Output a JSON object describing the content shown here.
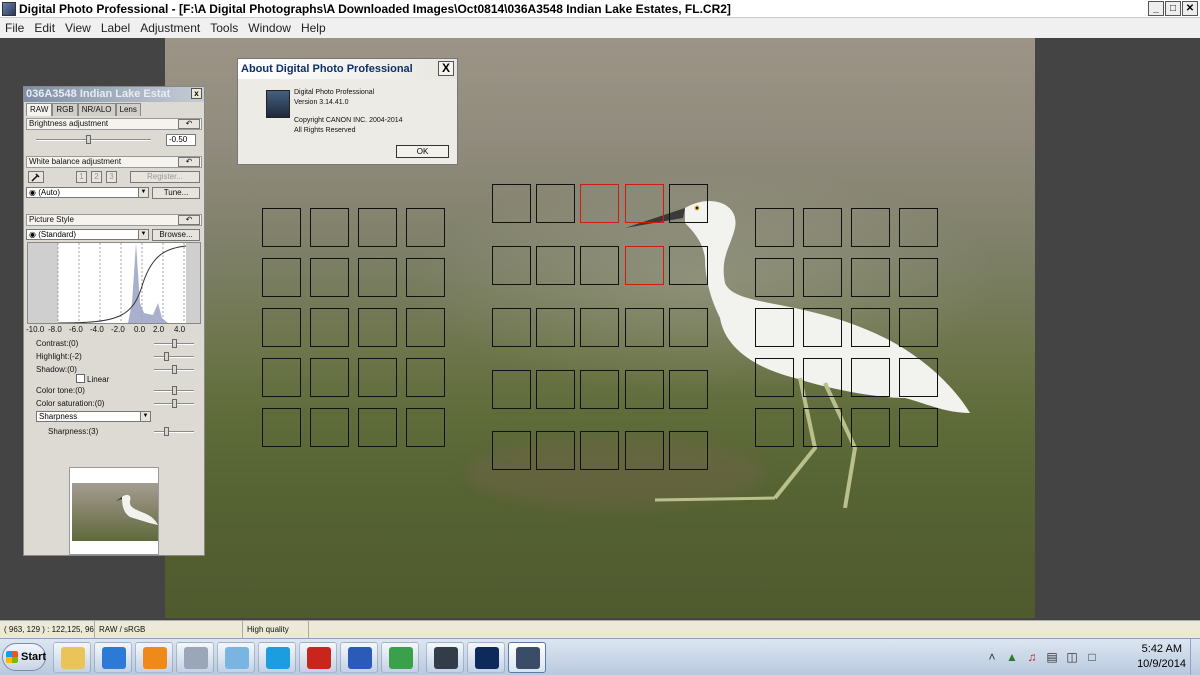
{
  "window": {
    "title": "Digital Photo Professional - [F:\\A Digital Photographs\\A Downloaded Images\\Oct0814\\036A3548  Indian Lake Estates, FL.CR2]",
    "min": "_",
    "max": "□",
    "close": "✕"
  },
  "menu": [
    "File",
    "Edit",
    "View",
    "Label",
    "Adjustment",
    "Tools",
    "Window",
    "Help"
  ],
  "palette": {
    "title": "036A3548  Indian Lake Estat",
    "close": "x",
    "tabs": [
      "RAW",
      "RGB",
      "NR/ALO",
      "Lens"
    ],
    "brightness": {
      "header": "Brightness adjustment",
      "value": "-0.50",
      "position": 0.45
    },
    "white_balance": {
      "header": "White balance adjustment",
      "custom_buttons": [
        "1",
        "2",
        "3"
      ],
      "register": "Register...",
      "preset": "(Auto)",
      "tune": "Tune..."
    },
    "picture_style": {
      "header": "Picture Style",
      "preset": "(Standard)",
      "browse": "Browse...",
      "axis_labels": [
        "-10.0",
        "-8.0",
        "-6.0",
        "-4.0",
        "-2.0",
        "0.0",
        "2.0",
        "4.0"
      ]
    },
    "sliders": [
      {
        "label": "Contrast:(0)",
        "position": 0.5
      },
      {
        "label": "Highlight:(-2)",
        "position": 0.3
      },
      {
        "label": "Shadow:(0)",
        "position": 0.5
      }
    ],
    "linear": "Linear",
    "sliders2": [
      {
        "label": "Color tone:(0)",
        "position": 0.5
      },
      {
        "label": "Color saturation:(0)",
        "position": 0.5
      }
    ],
    "sharpness_mode": "Sharpness",
    "sharpness": {
      "label": "Sharpness:(3)",
      "position": 0.3
    },
    "reset": "↶"
  },
  "about": {
    "title": "About Digital Photo Professional",
    "close": "X",
    "line1": "Digital Photo Professional",
    "line2": "Version 3.14.41.0",
    "line3": "Copyright CANON INC. 2004-2014",
    "line4": "All Rights Reserved",
    "ok": "OK"
  },
  "status": {
    "coords": "( 963, 129 ) : 122,125, 96",
    "mode": "RAW / sRGB",
    "quality": "High quality"
  },
  "taskbar": {
    "start": "Start",
    "apps": [
      "explorer-icon",
      "internet-explorer-icon",
      "media-player-icon",
      "calculator-icon",
      "photo-viewer-icon",
      "skype-icon",
      "acrobat-icon",
      "word-icon",
      "chrome-icon",
      "camera-utility-icon",
      "photoshop-icon",
      "digital-photo-professional-icon"
    ],
    "time": "5:42 AM",
    "date": "10/9/2014"
  }
}
